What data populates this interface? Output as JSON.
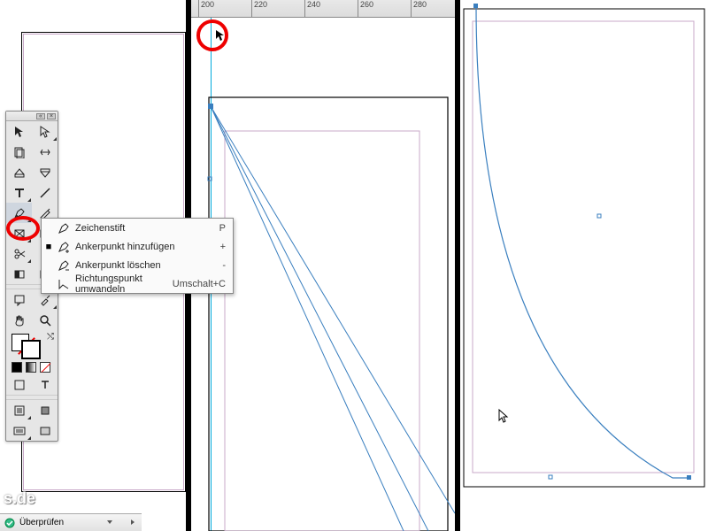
{
  "ruler": {
    "ticks": [
      "200",
      "220",
      "240",
      "260",
      "280"
    ]
  },
  "toolbox": {
    "header": {
      "collapse": "«",
      "close": "×"
    }
  },
  "flyout": {
    "items": [
      {
        "selected": "",
        "label": "Zeichenstift",
        "shortcut": "P"
      },
      {
        "selected": "■",
        "label": "Ankerpunkt hinzufügen",
        "shortcut": "+"
      },
      {
        "selected": "",
        "label": "Ankerpunkt löschen",
        "shortcut": "-"
      },
      {
        "selected": "",
        "label": "Richtungspunkt umwandeln",
        "shortcut": "Umschalt+C"
      }
    ]
  },
  "statusbar": {
    "label": "Überprüfen"
  },
  "watermark": "s.de",
  "cursor_glyph": "▶",
  "colors": {
    "guide": "#00aadd",
    "margin": "#c8a8c8",
    "highlight": "#e00"
  }
}
